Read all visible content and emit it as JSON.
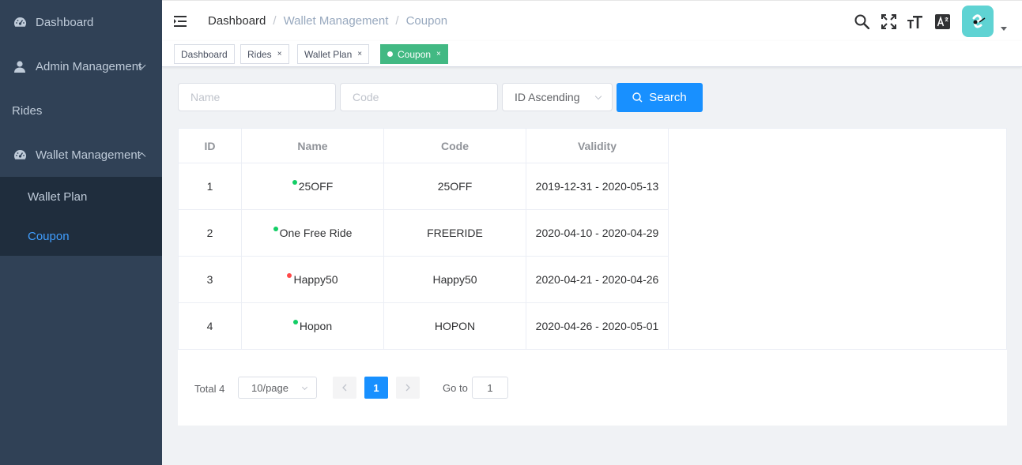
{
  "sidebar": {
    "items": [
      {
        "label": "Dashboard",
        "icon": "dashboard-icon"
      },
      {
        "label": "Admin Management",
        "icon": "user-icon"
      },
      {
        "label": "Rides"
      },
      {
        "label": "Wallet Management",
        "icon": "dashboard-icon"
      }
    ],
    "submenu": [
      {
        "label": "Wallet Plan"
      },
      {
        "label": "Coupon"
      }
    ]
  },
  "navbar": {
    "breadcrumb": [
      "Dashboard",
      "Wallet Management",
      "Coupon"
    ],
    "separator": "/"
  },
  "tags": [
    {
      "label": "Dashboard"
    },
    {
      "label": "Rides",
      "close": "×"
    },
    {
      "label": "Wallet Plan",
      "close": "×"
    },
    {
      "label": "Coupon",
      "close": "×"
    }
  ],
  "filters": {
    "name_placeholder": "Name",
    "code_placeholder": "Code",
    "sort_selected": "ID Ascending",
    "search_label": "Search"
  },
  "table": {
    "headers": [
      "ID",
      "Name",
      "Code",
      "Validity"
    ],
    "rows": [
      {
        "id": "1",
        "name": "25OFF",
        "code": "25OFF",
        "validity": "2019-12-31 - 2020-05-13",
        "status_color": "#13ce66"
      },
      {
        "id": "2",
        "name": "One Free Ride",
        "code": "FREERIDE",
        "validity": "2020-04-10 - 2020-04-29",
        "status_color": "#13ce66"
      },
      {
        "id": "3",
        "name": "Happy50",
        "code": "Happy50",
        "validity": "2020-04-21 - 2020-04-26",
        "status_color": "#ff4949"
      },
      {
        "id": "4",
        "name": "Hopon",
        "code": "HOPON",
        "validity": "2020-04-26 - 2020-05-01",
        "status_color": "#13ce66"
      }
    ]
  },
  "pagination": {
    "total": "Total 4",
    "page_size": "10/page",
    "current_page": "1",
    "goto_label": "Go to",
    "goto_value": "1"
  },
  "colors": {
    "sidebar_bg": "#304156",
    "active_link": "#409eff",
    "active_tag": "#42b983",
    "primary_button": "#1890ff"
  }
}
